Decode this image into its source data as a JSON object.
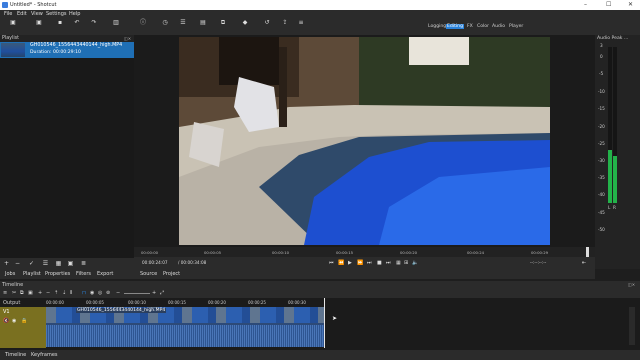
{
  "window": {
    "title": "Untitled* - Shotcut",
    "controls": [
      "–",
      "☐",
      "✕"
    ]
  },
  "menu": [
    "File",
    "Edit",
    "View",
    "Settings",
    "Help"
  ],
  "toolbar": {
    "items": [
      {
        "label": "Open File",
        "icon": "folder-open-icon"
      },
      {
        "label": "Open Other...",
        "icon": "folder-icon"
      },
      {
        "label": "Save",
        "icon": "save-icon"
      },
      {
        "label": "Undo",
        "icon": "undo-icon"
      },
      {
        "label": "Redo",
        "icon": "redo-icon"
      },
      {
        "label": "Peak Meter",
        "icon": "peak-meter-icon"
      },
      {
        "label": "Properties",
        "icon": "properties-icon"
      },
      {
        "label": "Recent",
        "icon": "recent-icon"
      },
      {
        "label": "Playlist",
        "icon": "playlist-icon"
      },
      {
        "label": "Timeline",
        "icon": "timeline-icon"
      },
      {
        "label": "Filters",
        "icon": "filters-icon"
      },
      {
        "label": "Keyframes",
        "icon": "keyframes-icon"
      },
      {
        "label": "History",
        "icon": "history-icon"
      },
      {
        "label": "Export",
        "icon": "export-icon"
      },
      {
        "label": "Jobs",
        "icon": "jobs-icon"
      }
    ],
    "modes": [
      "Logging",
      "Editing",
      "FX",
      "Color",
      "Audio",
      "Player"
    ],
    "active_mode": "Editing"
  },
  "playlist": {
    "title": "Playlist",
    "item": {
      "name": "GH010546_1556443440144_high.MP4",
      "duration": "Duration: 00:00:29:10"
    }
  },
  "left_tabs": [
    "Jobs",
    "Playlist",
    "Properties",
    "Filters",
    "Export"
  ],
  "ruler_ticks": [
    "00:00:00",
    "00:00:05",
    "00:00:10",
    "00:00:15",
    "00:00:20",
    "00:00:24",
    "00:00:29"
  ],
  "transport": {
    "position": "00:00:24:07",
    "duration": "/ 00:00:34:08",
    "tc_right": "--:--:--:--"
  },
  "source_tabs": [
    "Source",
    "Project"
  ],
  "audio": {
    "title": "Audio Peak ...",
    "scale": [
      "3",
      "0",
      "-5",
      "-10",
      "-15",
      "-20",
      "-25",
      "-30",
      "-35",
      "-40",
      "-45",
      "-50"
    ],
    "channels": [
      "L",
      "R"
    ],
    "levels": [
      0.34,
      0.3
    ]
  },
  "timeline": {
    "title": "Timeline",
    "output_label": "Output",
    "track": "V1",
    "clip_name": "GH010546_1556443440144_high.MP4",
    "ticks": [
      "00:00:00",
      "00:00:05",
      "00:00:10",
      "00:00:15",
      "00:00:20",
      "00:00:25",
      "00:00:30"
    ]
  },
  "bottom_tabs": [
    "Timeline",
    "Keyframes"
  ],
  "colors": {
    "accent": "#2a82da",
    "track_header": "#7a7020",
    "clip": "#2d4a78",
    "meter_green": "#23b34a"
  }
}
